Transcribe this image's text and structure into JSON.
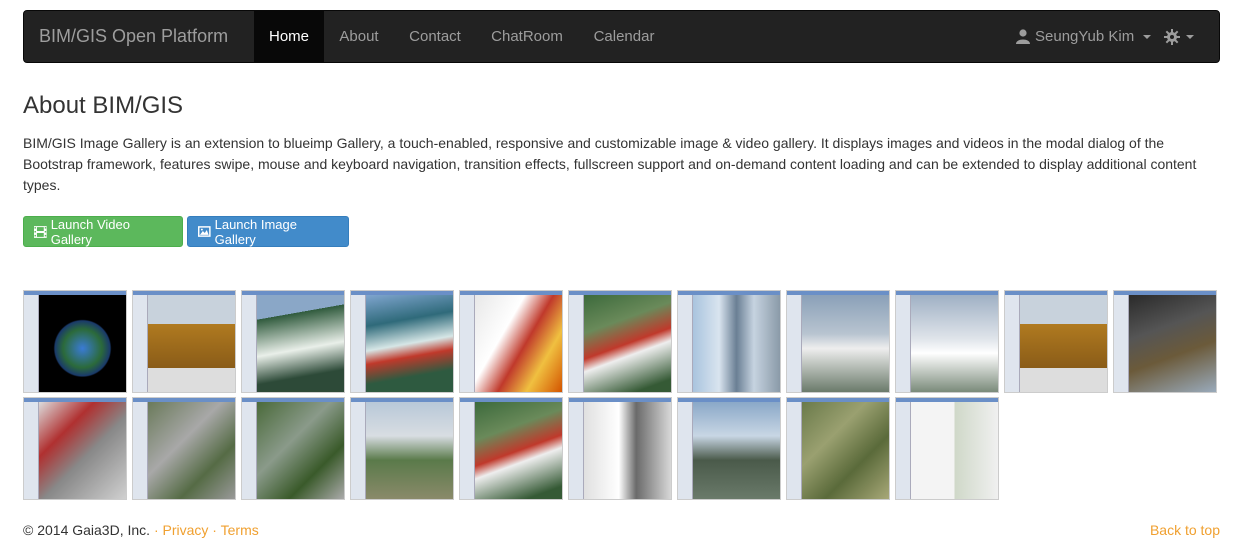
{
  "navbar": {
    "brand": "BIM/GIS Open Platform",
    "items": [
      {
        "label": "Home",
        "active": true
      },
      {
        "label": "About",
        "active": false
      },
      {
        "label": "Contact",
        "active": false
      },
      {
        "label": "ChatRoom",
        "active": false
      },
      {
        "label": "Calendar",
        "active": false
      }
    ],
    "user": "SeungYub Kim",
    "user_icon": "user-icon",
    "settings_icon": "gear-icon"
  },
  "main": {
    "title": "About BIM/GIS",
    "description": "BIM/GIS Image Gallery is an extension to blueimp Gallery, a touch-enabled, responsive and customizable image & video gallery. It displays images and videos in the modal dialog of the Bootstrap framework, features swipe, mouse and keyboard navigation, transition effects, fullscreen support and on-demand content loading and can be extended to display additional content types.",
    "buttons": {
      "video": {
        "label": "Launch Video Gallery",
        "icon": "film-icon",
        "color": "#5cb85c"
      },
      "image": {
        "label": "Launch Image Gallery",
        "icon": "picture-icon",
        "color": "#428bca"
      }
    }
  },
  "gallery": {
    "thumbnails": [
      {
        "scene": "globe"
      },
      {
        "scene": "building-orange"
      },
      {
        "scene": "terrain-green"
      },
      {
        "scene": "terrain-red"
      },
      {
        "scene": "interior-red"
      },
      {
        "scene": "campus-red"
      },
      {
        "scene": "tower-blue"
      },
      {
        "scene": "tower-grey"
      },
      {
        "scene": "tower-white"
      },
      {
        "scene": "building-orange"
      },
      {
        "scene": "interior-dark"
      },
      {
        "scene": "aerial-red"
      },
      {
        "scene": "aerial-grey"
      },
      {
        "scene": "aerial-green"
      },
      {
        "scene": "tower-street"
      },
      {
        "scene": "campus-red"
      },
      {
        "scene": "corridor-white"
      },
      {
        "scene": "city-blue"
      },
      {
        "scene": "aerial-satellite"
      },
      {
        "scene": "map-panel"
      }
    ]
  },
  "footer": {
    "copyright": "© 2014 Gaia3D, Inc.",
    "sep1": " · ",
    "privacy": "Privacy",
    "sep2": " · ",
    "terms": "Terms",
    "back_to_top": "Back to top",
    "link_color": "#f0a030"
  }
}
